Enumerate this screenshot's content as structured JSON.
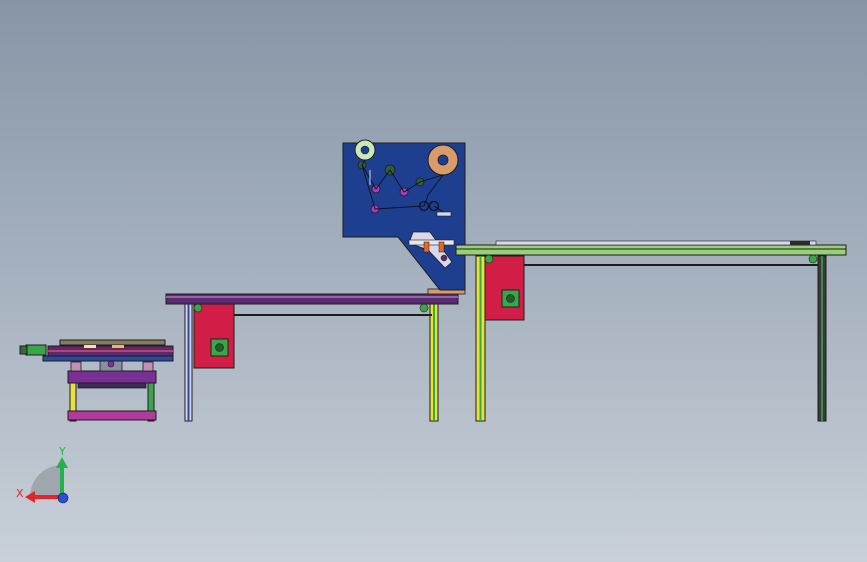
{
  "viewport": {
    "background_top": "#8795a6",
    "background_bottom": "#c9d0d8"
  },
  "colors": {
    "labeler_body": "#1e3f8f",
    "conveyor_purple": "#5a2a6e",
    "conveyor_green": "#9acf7a",
    "leg_yellow": "#e6e23c",
    "motor_red": "#d21e47",
    "motor_green": "#3aa64a",
    "roller_orange": "#d99a6c",
    "axis_x": "#e0262b",
    "axis_y": "#24b34a",
    "axis_z": "#2a4fd6"
  },
  "icons": {
    "triad": "coordinate-triad-icon",
    "roller": "roller-icon",
    "motor": "motor-icon"
  },
  "triad": {
    "x_label": "X",
    "y_label": "Y"
  }
}
